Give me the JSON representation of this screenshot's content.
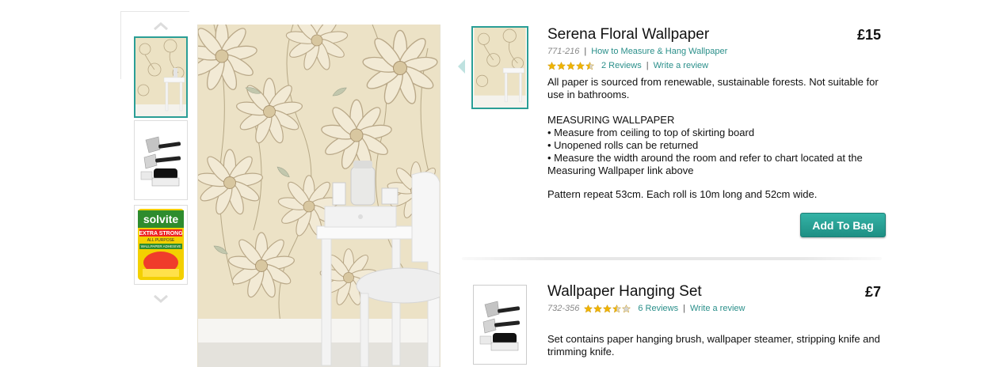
{
  "gallery": {
    "thumbnails": [
      {
        "name": "wallpaper-room",
        "active": true
      },
      {
        "name": "hanging-set-tools",
        "active": false
      },
      {
        "name": "paste-packet",
        "active": false
      }
    ],
    "paste_brand": "solvite",
    "paste_strength": "EXTRA STRONG",
    "paste_purpose": "ALL PURPOSE",
    "paste_type": "WALLPAPER ADHESIVE"
  },
  "products": [
    {
      "title": "Serena Floral Wallpaper",
      "price": "£15",
      "code": "771-216",
      "guide_link": "How to Measure & Hang Wallpaper",
      "rating": 4.5,
      "reviews_label": "2 Reviews",
      "write_review_label": "Write a review",
      "description": [
        "All paper is sourced from renewable, sustainable forests. Not suitable for use in bathrooms.",
        "MEASURING WALLPAPER",
        "• Measure from ceiling to top of skirting board",
        "• Unopened rolls can be returned",
        "• Measure the width around the room and refer to chart located at the Measuring Wallpaper link above",
        "Pattern repeat 53cm. Each roll is 10m long and 52cm wide."
      ],
      "add_to_bag_label": "Add To Bag"
    },
    {
      "title": "Wallpaper Hanging Set",
      "price": "£7",
      "code": "732-356",
      "rating": 3.5,
      "reviews_label": "6 Reviews",
      "write_review_label": "Write a review",
      "description": [
        "Set contains paper hanging brush, wallpaper steamer, stripping knife and trimming knife."
      ]
    }
  ],
  "colors": {
    "accent": "#2a9e96",
    "link": "#2a8f8a",
    "star": "#f0b400",
    "button": "#26a196"
  },
  "icons": {
    "up": "chevron-up-icon",
    "down": "chevron-down-icon",
    "star": "star-icon"
  }
}
